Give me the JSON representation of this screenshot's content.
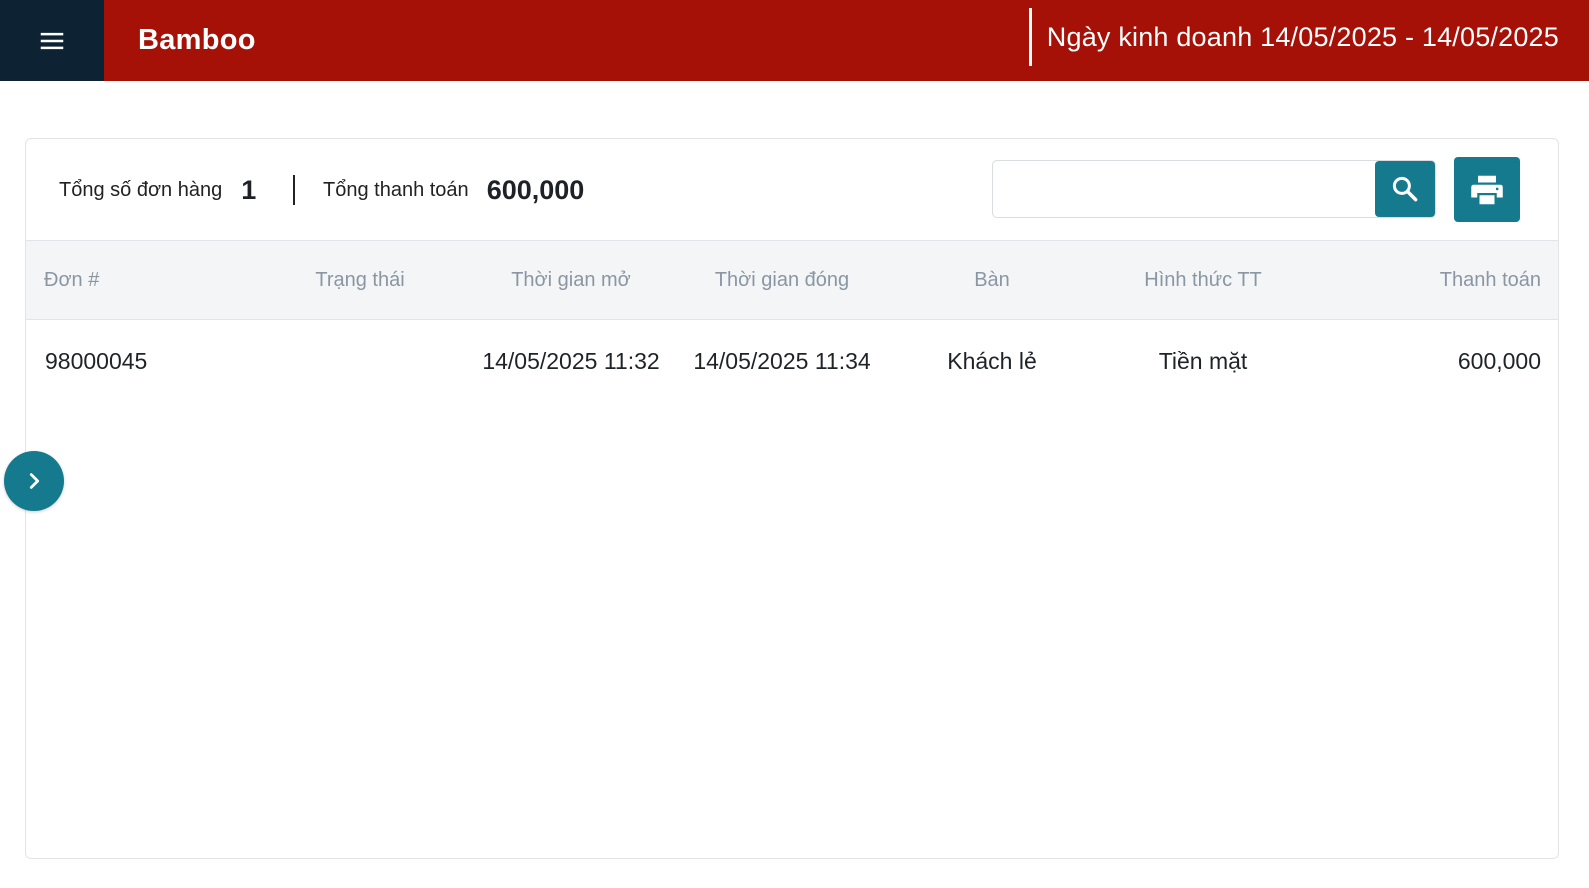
{
  "header": {
    "app_title": "Bamboo",
    "business_date": "Ngày kinh doanh 14/05/2025 - 14/05/2025",
    "bg_color": "#a51007",
    "menu_bg_color": "#0d2233"
  },
  "summary": {
    "total_orders_label": "Tổng số đơn hàng",
    "total_orders_value": "1",
    "total_payment_label": "Tổng thanh toán",
    "total_payment_value": "600,000"
  },
  "search": {
    "value": "",
    "placeholder": ""
  },
  "accent_color": "#167a8e",
  "table": {
    "columns": [
      "Đơn #",
      "Trạng thái",
      "Thời gian mở",
      "Thời gian đóng",
      "Bàn",
      "Hình thức TT",
      "Thanh toán"
    ],
    "rows": [
      {
        "order_no": "98000045",
        "status": "",
        "open_time": "14/05/2025 11:32",
        "close_time": "14/05/2025 11:34",
        "table": "Khách lẻ",
        "payment_method": "Tiền mặt",
        "payment": "600,000"
      }
    ]
  },
  "icons": {
    "menu": "hamburger-menu-icon",
    "search": "search-icon",
    "print": "printer-icon",
    "side_toggle": "chevron-right-icon"
  }
}
